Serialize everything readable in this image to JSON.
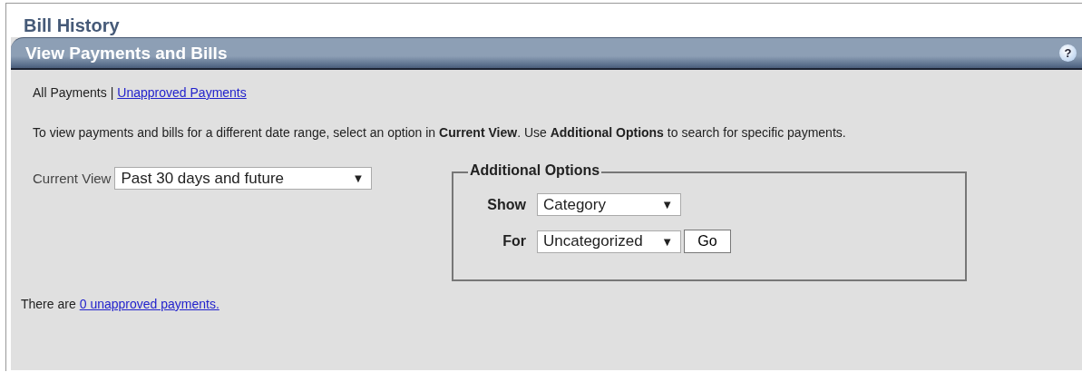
{
  "page_title": "Bill History",
  "panel": {
    "title": "View Payments and Bills",
    "help_icon": "?"
  },
  "view_links": [
    {
      "label": "All Payments",
      "kind": "text"
    },
    {
      "label": "|",
      "kind": "separator"
    },
    {
      "label": "Unapproved Payments",
      "kind": "link"
    }
  ],
  "instructions": "To view payments and bills for a different date range, select an option in **Current View**. Use **Additional Options** to search for specific payments.",
  "current_view": {
    "label": "Current View",
    "value": "Past 30 days and future",
    "arrow": "▼"
  },
  "additional_options": {
    "legend": "Additional Options",
    "fields": [
      {
        "label": "Show",
        "value": "Category",
        "arrow": "▼"
      },
      {
        "label": "For",
        "value": "Uncategorized",
        "arrow": "▼",
        "button": "Go"
      }
    ]
  },
  "footer": {
    "text": "There are",
    "link": "0 unapproved payments."
  }
}
